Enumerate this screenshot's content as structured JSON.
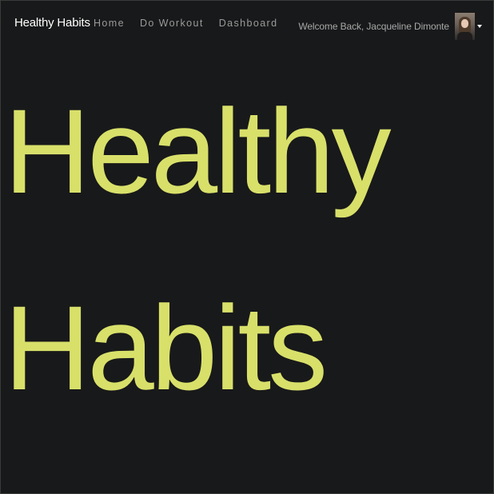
{
  "navbar": {
    "brand": "Healthy Habits",
    "links": [
      {
        "label": "Home"
      },
      {
        "label": "Do Workout"
      },
      {
        "label": "Dashboard"
      }
    ],
    "welcome_text": "Welcome Back, Jacqueline Dimonte",
    "dropdown_icon": "caret-down-icon"
  },
  "hero": {
    "line1": "Healthy",
    "line2": "Habits"
  },
  "colors": {
    "background": "#18191a",
    "accent": "#d8e06a",
    "nav_text": "#9a9a9a",
    "brand_text": "#ffffff"
  }
}
